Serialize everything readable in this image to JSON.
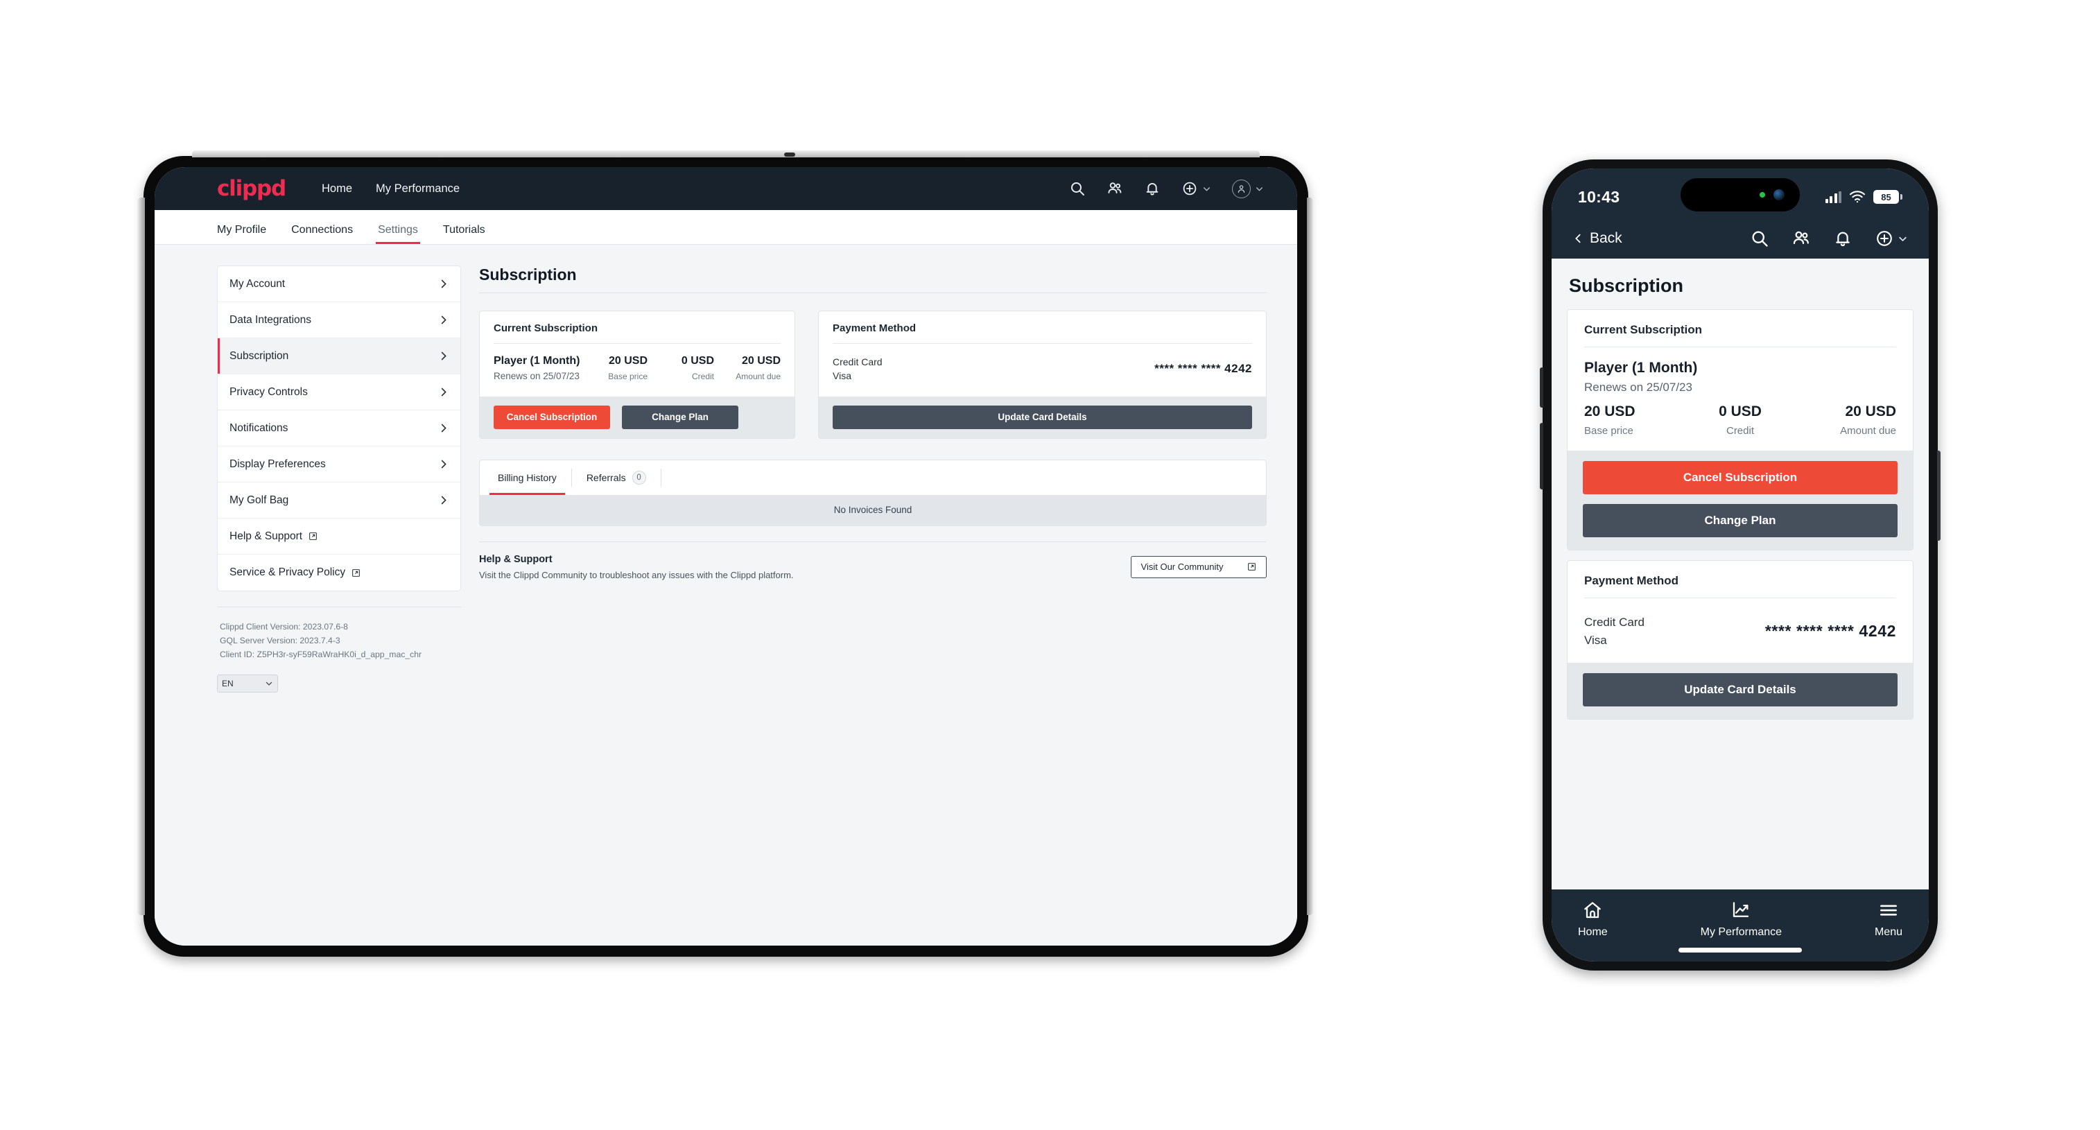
{
  "brand": {
    "logo_text": "clippd",
    "accent_red": "#ef2b50",
    "danger_red": "#ee4a38",
    "dark_navy": "#18222c",
    "slate": "#46505c"
  },
  "tablet": {
    "appbar": {
      "nav_links": [
        "Home",
        "My Performance"
      ],
      "icons": [
        "search-icon",
        "people-icon",
        "bell-icon",
        "plus-circle-icon",
        "avatar-icon"
      ]
    },
    "tabs": [
      {
        "label": "My Profile",
        "active": false
      },
      {
        "label": "Connections",
        "active": false
      },
      {
        "label": "Settings",
        "active": true
      },
      {
        "label": "Tutorials",
        "active": false
      }
    ],
    "sidebar": {
      "items": [
        {
          "label": "My Account",
          "active": false,
          "external": false
        },
        {
          "label": "Data Integrations",
          "active": false,
          "external": false
        },
        {
          "label": "Subscription",
          "active": true,
          "external": false
        },
        {
          "label": "Privacy Controls",
          "active": false,
          "external": false
        },
        {
          "label": "Notifications",
          "active": false,
          "external": false
        },
        {
          "label": "Display Preferences",
          "active": false,
          "external": false
        },
        {
          "label": "My Golf Bag",
          "active": false,
          "external": false
        },
        {
          "label": "Help & Support",
          "active": false,
          "external": true
        },
        {
          "label": "Service & Privacy Policy",
          "active": false,
          "external": true
        }
      ],
      "meta": {
        "client_version": "Clippd Client Version: 2023.07.6-8",
        "server_version": "GQL Server Version: 2023.7.4-3",
        "client_id": "Client ID: Z5PH3r-syF59RaWraHK0i_d_app_mac_chr"
      },
      "language": {
        "selected": "EN",
        "options": [
          "EN"
        ]
      }
    },
    "main": {
      "page_title": "Subscription",
      "current_subscription": {
        "card_title": "Current Subscription",
        "plan_name": "Player (1 Month)",
        "renews": "Renews on 25/07/23",
        "amounts": [
          {
            "value": "20 USD",
            "label": "Base price"
          },
          {
            "value": "0 USD",
            "label": "Credit"
          },
          {
            "value": "20 USD",
            "label": "Amount due"
          }
        ],
        "cancel_label": "Cancel Subscription",
        "change_label": "Change Plan"
      },
      "payment_method": {
        "card_title": "Payment Method",
        "type": "Credit Card",
        "brand": "Visa",
        "number": "**** **** **** 4242",
        "update_label": "Update Card Details"
      },
      "billing": {
        "tabs": [
          {
            "label": "Billing History",
            "active": true,
            "badge": null
          },
          {
            "label": "Referrals",
            "active": false,
            "badge": "0"
          }
        ],
        "empty_text": "No Invoices Found"
      },
      "help": {
        "title": "Help & Support",
        "subtitle": "Visit the Clippd Community to troubleshoot any issues with the Clippd platform.",
        "button_label": "Visit Our Community"
      }
    }
  },
  "phone": {
    "status": {
      "time": "10:43",
      "battery": "85",
      "signal": "cellular-signal-icon",
      "wifi": "wifi-icon"
    },
    "navbar": {
      "back_label": "Back",
      "icons": [
        "search-icon",
        "people-icon",
        "bell-icon",
        "plus-circle-icon"
      ]
    },
    "page_title": "Subscription",
    "current_subscription": {
      "card_title": "Current Subscription",
      "plan_name": "Player (1 Month)",
      "renews": "Renews on 25/07/23",
      "amounts": [
        {
          "value": "20 USD",
          "label": "Base price"
        },
        {
          "value": "0 USD",
          "label": "Credit"
        },
        {
          "value": "20 USD",
          "label": "Amount due"
        }
      ],
      "cancel_label": "Cancel Subscription",
      "change_label": "Change Plan"
    },
    "payment_method": {
      "card_title": "Payment Method",
      "type": "Credit Card",
      "brand": "Visa",
      "number": "**** **** **** 4242",
      "update_label": "Update Card Details"
    },
    "tabbar": [
      {
        "label": "Home",
        "icon": "home-icon"
      },
      {
        "label": "My Performance",
        "icon": "chart-line-icon"
      },
      {
        "label": "Menu",
        "icon": "hamburger-menu-icon"
      }
    ]
  }
}
